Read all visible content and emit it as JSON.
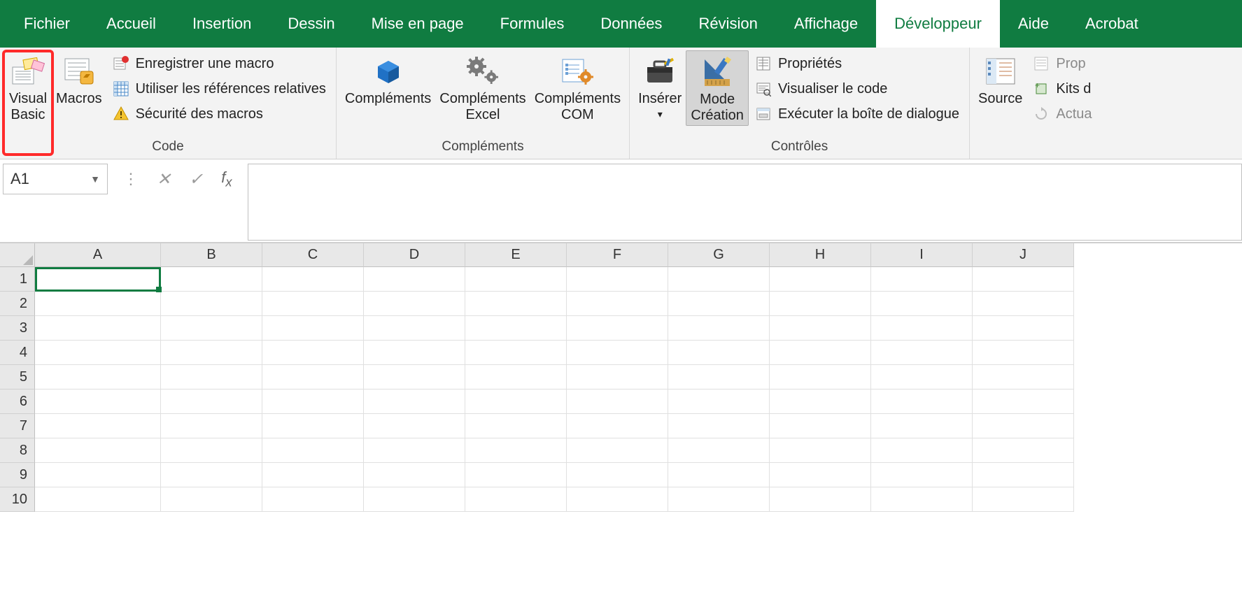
{
  "tabs": [
    {
      "label": "Fichier"
    },
    {
      "label": "Accueil"
    },
    {
      "label": "Insertion"
    },
    {
      "label": "Dessin"
    },
    {
      "label": "Mise en page"
    },
    {
      "label": "Formules"
    },
    {
      "label": "Données"
    },
    {
      "label": "Révision"
    },
    {
      "label": "Affichage"
    },
    {
      "label": "Développeur",
      "active": true
    },
    {
      "label": "Aide"
    },
    {
      "label": "Acrobat"
    }
  ],
  "ribbon": {
    "code_group": {
      "label": "Code",
      "visual_basic": {
        "line1": "Visual",
        "line2": "Basic"
      },
      "macros": "Macros",
      "record_macro": "Enregistrer une macro",
      "relative_refs": "Utiliser les références relatives",
      "macro_security": "Sécurité des macros"
    },
    "addins_group": {
      "label": "Compléments",
      "addins": "Compléments",
      "excel_addins": {
        "line1": "Compléments",
        "line2": "Excel"
      },
      "com_addins": {
        "line1": "Compléments",
        "line2": "COM"
      }
    },
    "controls_group": {
      "label": "Contrôles",
      "insert": "Insérer",
      "design_mode": {
        "line1": "Mode",
        "line2": "Création"
      },
      "properties": "Propriétés",
      "view_code": "Visualiser le code",
      "run_dialog": "Exécuter la boîte de dialogue"
    },
    "xml_group": {
      "source": "Source",
      "map_props": "Prop",
      "expansion_kits": "Kits d",
      "refresh": "Actua"
    }
  },
  "formula_bar": {
    "name_box": "A1",
    "formula": ""
  },
  "columns": [
    "A",
    "B",
    "C",
    "D",
    "E",
    "F",
    "G",
    "H",
    "I",
    "J"
  ],
  "rows": [
    "1",
    "2",
    "3",
    "4",
    "5",
    "6",
    "7",
    "8",
    "9",
    "10"
  ],
  "active_cell": "A1"
}
